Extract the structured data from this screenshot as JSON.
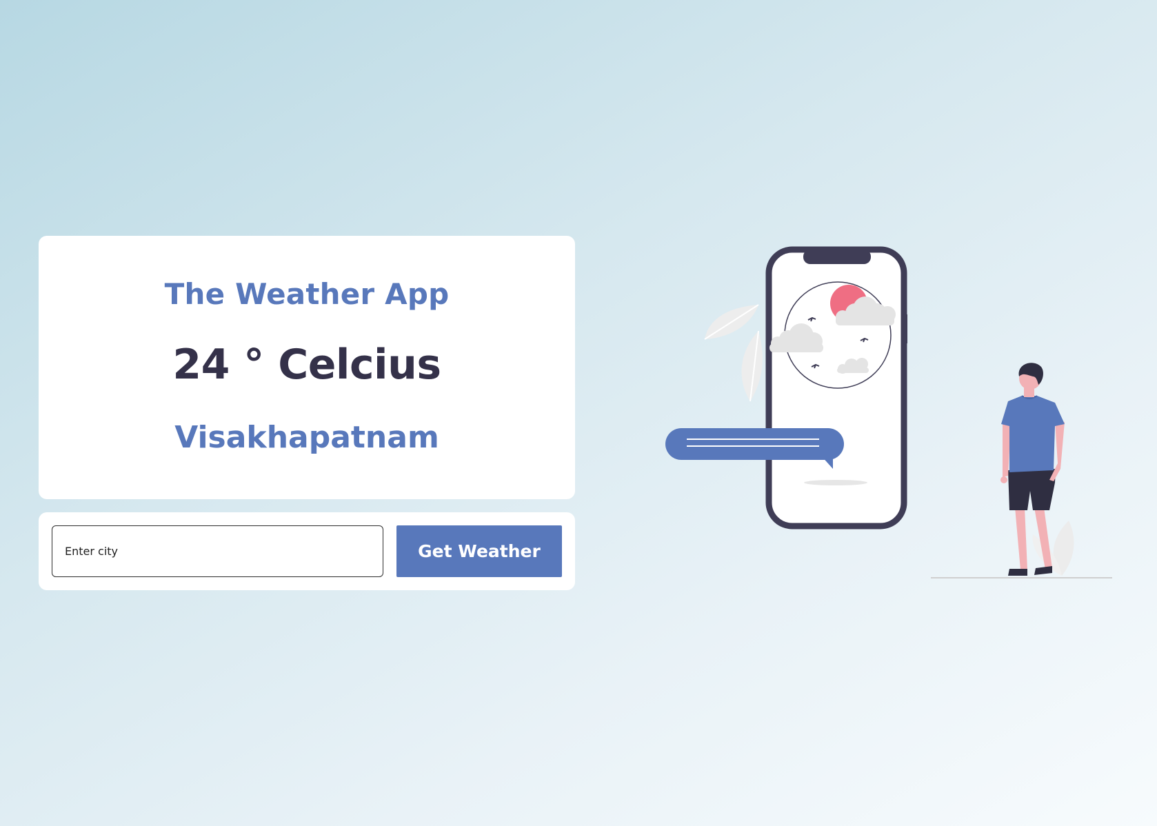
{
  "app": {
    "title": "The Weather App",
    "temperature": "24 ° Celcius",
    "city": "Visakhapatnam"
  },
  "search": {
    "placeholder": "Enter city",
    "value": "",
    "button_label": "Get Weather"
  },
  "colors": {
    "accent": "#5878bb",
    "dark_text": "#343149",
    "card_bg": "#ffffff",
    "sun": "#ef6e83"
  },
  "illustration": {
    "icons": [
      "phone-icon",
      "sun-icon",
      "cloud-icon",
      "bird-icon",
      "chat-bubble-icon",
      "person-icon",
      "leaf-icon"
    ]
  }
}
